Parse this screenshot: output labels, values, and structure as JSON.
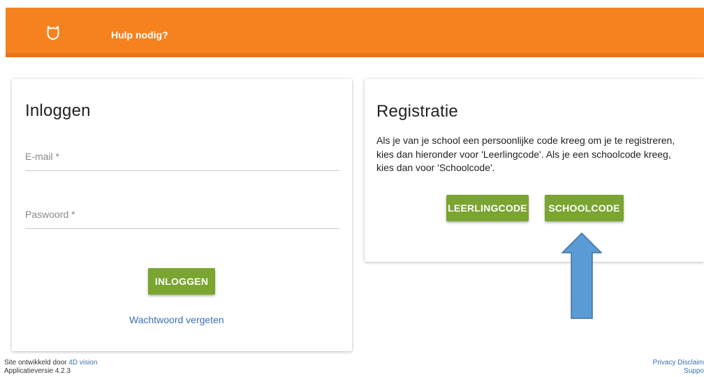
{
  "header": {
    "help_label": "Hulp nodig?"
  },
  "login": {
    "title": "Inloggen",
    "email_placeholder": "E-mail *",
    "password_placeholder": "Paswoord *",
    "login_button": "INLOGGEN",
    "forgot_link": "Wachtwoord vergeten"
  },
  "registration": {
    "title": "Registratie",
    "description": "Als je van je school een persoonlijke code kreeg om je te registreren, kies dan hieronder voor 'Leerlingcode'. Als je een schoolcode kreeg, kies dan voor 'Schoolcode'.",
    "student_code_button": "LEERLINGCODE",
    "school_code_button": "SCHOOLCODE"
  },
  "footer": {
    "developed_by_prefix": "Site ontwikkeld door",
    "developer_link": "4D vision",
    "version_text": "Applicatieversie 4.2.3",
    "privacy_link": "Privacy Disclaim",
    "support_link": "Suppo"
  },
  "colors": {
    "header": "#f5821f",
    "button": "#7aa530",
    "link": "#3a6fb0",
    "arrow": "#5b9bd5"
  },
  "icons": {
    "logo": "owl-logo-icon",
    "annotation": "up-arrow-annotation"
  }
}
